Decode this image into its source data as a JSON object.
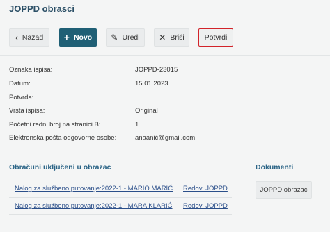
{
  "page": {
    "title": "JOPPD obrasci"
  },
  "toolbar": {
    "back_label": "Nazad",
    "new_label": "Novo",
    "edit_label": "Uredi",
    "delete_label": "Briši",
    "confirm_label": "Potvrdi"
  },
  "details": {
    "fields": [
      {
        "label": "Oznaka ispisa:",
        "value": "JOPPD-23015"
      },
      {
        "label": "Datum:",
        "value": "15.01.2023"
      },
      {
        "label": "Potvrda:",
        "value": ""
      },
      {
        "label": "Vrsta ispisa:",
        "value": "Original"
      },
      {
        "label": "Početni redni broj na stranici B:",
        "value": "1"
      },
      {
        "label": "Elektronska pošta odgovorne osobe:",
        "value": "anaanić@gmail.com"
      }
    ]
  },
  "calculations": {
    "title": "Obračuni uključeni u obrazac",
    "rows": [
      {
        "name": "Nalog za službeno putovanje:2022-1 - MARIO MARIĆ",
        "type": "Redovi JOPPD"
      },
      {
        "name": "Nalog za službeno putovanje:2022-1 - MARA KLARIĆ",
        "type": "Redovi JOPPD"
      }
    ]
  },
  "documents": {
    "title": "Dokumenti",
    "button_label": "JOPPD obrazac"
  },
  "colors": {
    "primary": "#1f5f75",
    "highlight_border": "#d2232a",
    "section_title": "#2b6486"
  }
}
